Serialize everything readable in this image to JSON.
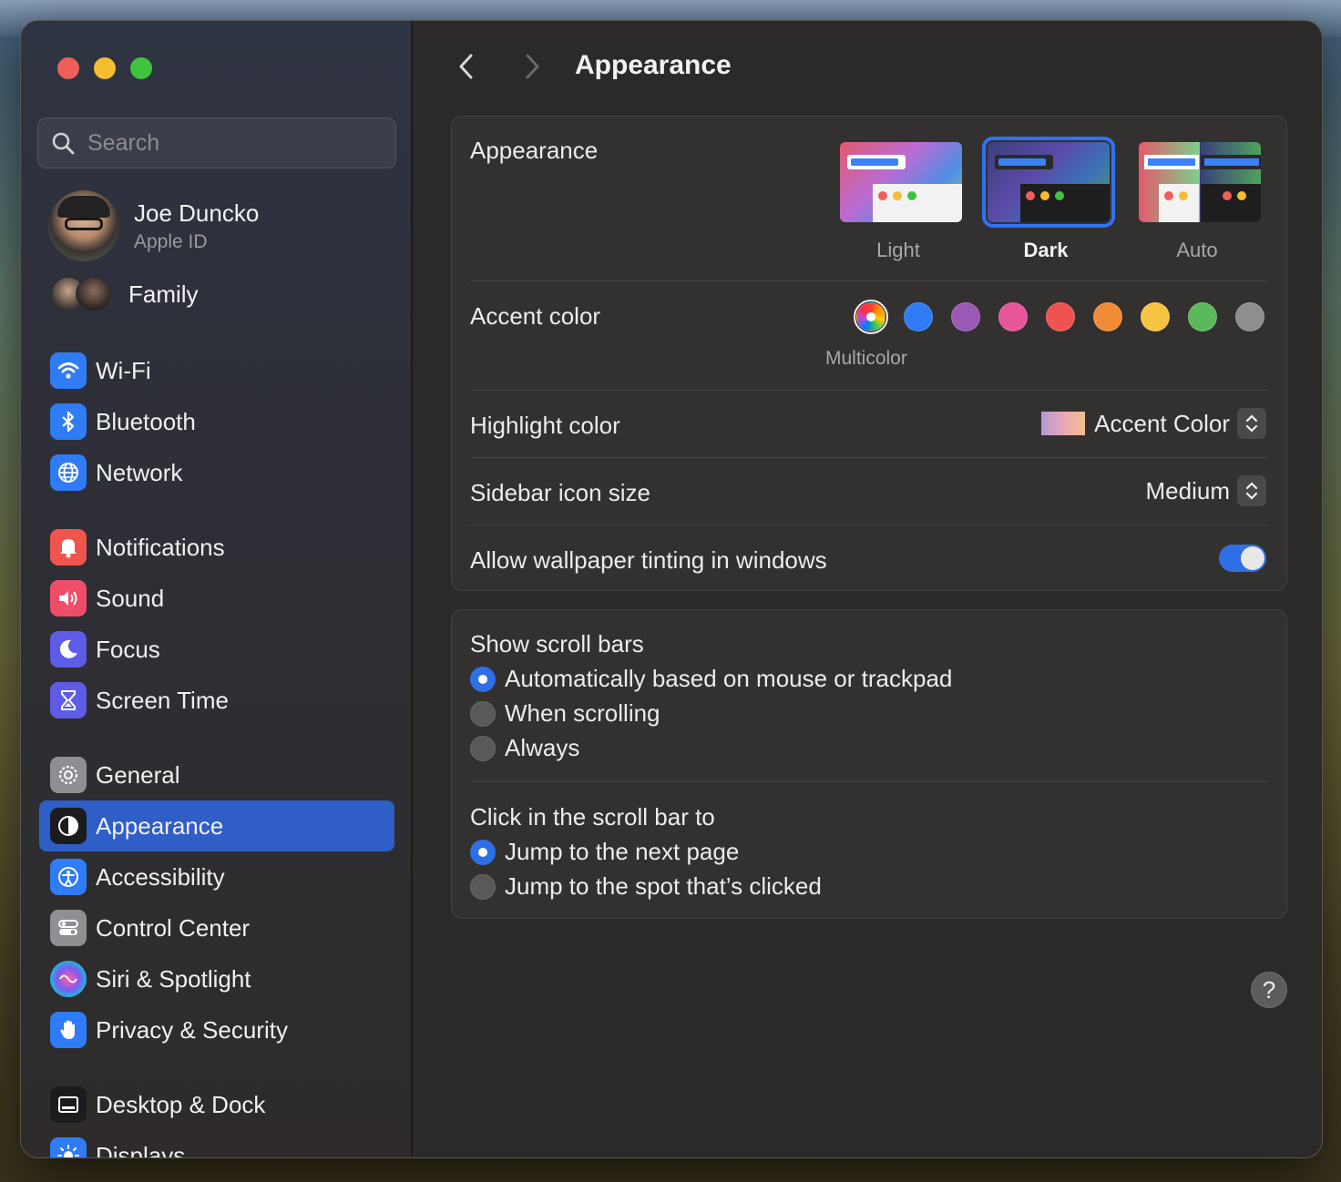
{
  "window": {
    "title": "Appearance"
  },
  "search": {
    "placeholder": "Search"
  },
  "profile": {
    "name": "Joe Duncko",
    "subtitle": "Apple ID"
  },
  "family": {
    "label": "Family"
  },
  "sidebar": {
    "items": [
      {
        "label": "Wi-Fi",
        "icon": "wifi-icon",
        "color": "#2f7cf6"
      },
      {
        "label": "Bluetooth",
        "icon": "bluetooth-icon",
        "color": "#2f7cf6"
      },
      {
        "label": "Network",
        "icon": "globe-icon",
        "color": "#2f7cf6"
      },
      {
        "label": "Notifications",
        "icon": "bell-icon",
        "color": "#f0554d"
      },
      {
        "label": "Sound",
        "icon": "speaker-icon",
        "color": "#ef4d6a"
      },
      {
        "label": "Focus",
        "icon": "moon-icon",
        "color": "#5e5ce6"
      },
      {
        "label": "Screen Time",
        "icon": "hourglass-icon",
        "color": "#5e5ce6"
      },
      {
        "label": "General",
        "icon": "gear-icon",
        "color": "#8e8e93"
      },
      {
        "label": "Appearance",
        "icon": "appearance-icon",
        "color": "#1c1c1e",
        "active": true
      },
      {
        "label": "Accessibility",
        "icon": "accessibility-icon",
        "color": "#2f7cf6"
      },
      {
        "label": "Control Center",
        "icon": "toggles-icon",
        "color": "#8e8e93"
      },
      {
        "label": "Siri & Spotlight",
        "icon": "siri-icon",
        "color": "#3a2d5c"
      },
      {
        "label": "Privacy & Security",
        "icon": "hand-icon",
        "color": "#2f7cf6"
      },
      {
        "label": "Desktop & Dock",
        "icon": "dock-icon",
        "color": "#1c1c1e"
      },
      {
        "label": "Displays",
        "icon": "sun-icon",
        "color": "#2f7cf6"
      }
    ]
  },
  "main": {
    "appearance": {
      "label": "Appearance",
      "options": [
        {
          "label": "Light",
          "selected": false
        },
        {
          "label": "Dark",
          "selected": true
        },
        {
          "label": "Auto",
          "selected": false
        }
      ]
    },
    "accent": {
      "label": "Accent color",
      "caption": "Multicolor",
      "colors": [
        "multicolor",
        "#2f7cf6",
        "#9b59b6",
        "#e8559b",
        "#ef5350",
        "#ef8c35",
        "#f6c343",
        "#5cb85c",
        "#8e8e8e"
      ],
      "selected": "multicolor"
    },
    "highlight": {
      "label": "Highlight color",
      "value": "Accent Color"
    },
    "sidebar_icon_size": {
      "label": "Sidebar icon size",
      "value": "Medium"
    },
    "wallpaper_tinting": {
      "label": "Allow wallpaper tinting in windows",
      "enabled": true
    },
    "scroll_bars": {
      "label": "Show scroll bars",
      "options": [
        {
          "label": "Automatically based on mouse or trackpad",
          "selected": true
        },
        {
          "label": "When scrolling",
          "selected": false
        },
        {
          "label": "Always",
          "selected": false
        }
      ]
    },
    "click_scroll": {
      "label": "Click in the scroll bar to",
      "options": [
        {
          "label": "Jump to the next page",
          "selected": true
        },
        {
          "label": "Jump to the spot that’s clicked",
          "selected": false
        }
      ]
    },
    "help": {
      "label": "?"
    }
  }
}
